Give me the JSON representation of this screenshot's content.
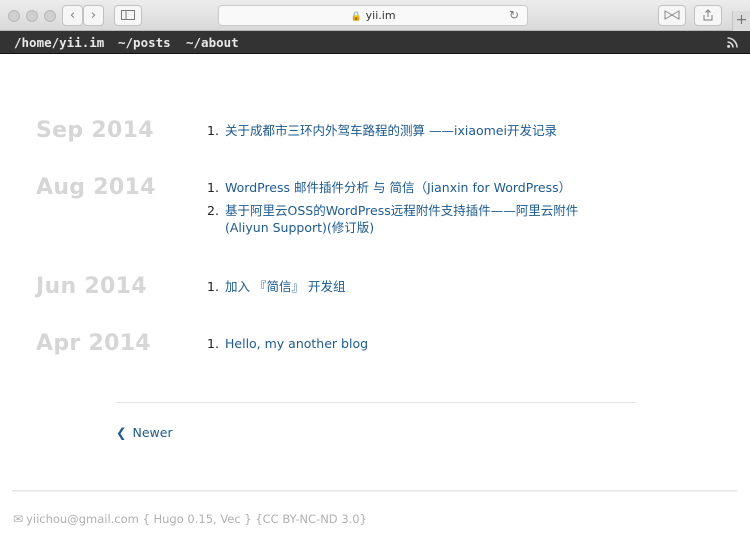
{
  "browser": {
    "url": "yii.im"
  },
  "topnav": {
    "links": [
      "/home/yii.im",
      "~/posts",
      "~/about"
    ]
  },
  "archive": [
    {
      "month": "Sep 2014",
      "posts": [
        "关于成都市三环内外驾车路程的测算 ——ixiaomei开发记录"
      ]
    },
    {
      "month": "Aug 2014",
      "posts": [
        "WordPress 邮件插件分析 与 简信（Jianxin for WordPress）",
        "基于阿里云OSS的WordPress远程附件支持插件——阿里云附件(Aliyun Support)(修订版)"
      ]
    },
    {
      "month": "Jun 2014",
      "posts": [
        "加入 『简信』 开发组"
      ]
    },
    {
      "month": "Apr 2014",
      "posts": [
        "Hello, my another blog"
      ]
    }
  ],
  "pagination": {
    "newer_label": "Newer"
  },
  "footer": {
    "text": "yiichou@gmail.com { Hugo 0.15, Vec } {CC BY-NC-ND 3.0}"
  },
  "colors": {
    "topbar_bg": "#333333",
    "link": "#1d5a8e",
    "month": "#d6d6d6"
  }
}
